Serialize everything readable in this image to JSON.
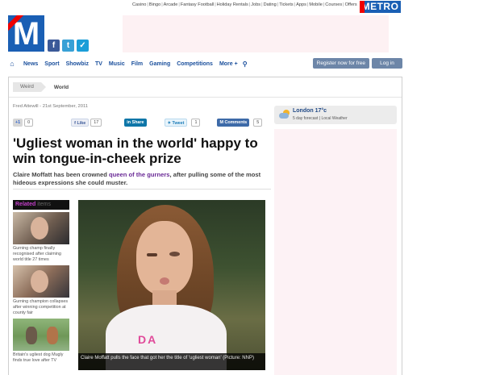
{
  "top_links": [
    "Casino",
    "Bingo",
    "Arcade",
    "Fantasy Football",
    "Holiday Rentals",
    "Jobs",
    "Dating",
    "Tickets",
    "Apps",
    "Mobile",
    "Courses",
    "Offers"
  ],
  "brand": {
    "top_logo": "METRO",
    "logo_letter": "M",
    "blue": "#1a5fb4",
    "red": "#e00000"
  },
  "social_icons": [
    "facebook-icon",
    "twitter-icon",
    "foursquare-icon"
  ],
  "nav": {
    "items": [
      "News",
      "Sport",
      "Showbiz",
      "TV",
      "Music",
      "Film",
      "Gaming",
      "Competitions",
      "More +"
    ],
    "register": "Register now for free",
    "login": "Log in"
  },
  "breadcrumb": {
    "section": "Weird",
    "subsection": "World"
  },
  "article": {
    "byline": "Fred Attewill - 21st September, 2011",
    "share": {
      "plus_label": "+1",
      "plus_count": "0",
      "like_label": "Like",
      "like_count": "17",
      "linkedin_label": "Share",
      "tweet_label": "Tweet",
      "tweet_count": "1",
      "comments_label": "Comments",
      "comments_count": "5"
    },
    "headline": "'Ugliest woman in the world' happy to win tongue-in-cheek prize",
    "standfirst_before": "Claire Moffatt has been crowned ",
    "standfirst_link": "queen of the gurners",
    "standfirst_after": ", after pulling some of the most hideous expressions she could muster.",
    "photo_caption": "Claire Moffatt pulls the face that got her the title of 'ugliest woman' (Picture: NNP)",
    "photo_print": "DA"
  },
  "related": {
    "heading_a": "Related",
    "heading_b": "items",
    "items": [
      {
        "caption": "Gurning champ finally recognised after claiming world title 27 times"
      },
      {
        "caption": "Gurning champion collapses after winning competition at county fair"
      },
      {
        "caption": "Britain's ugliest dog Mugly finds true love after TV"
      }
    ]
  },
  "weather": {
    "city": "London 17°c",
    "links": "5 day forecast | Local Weather"
  }
}
